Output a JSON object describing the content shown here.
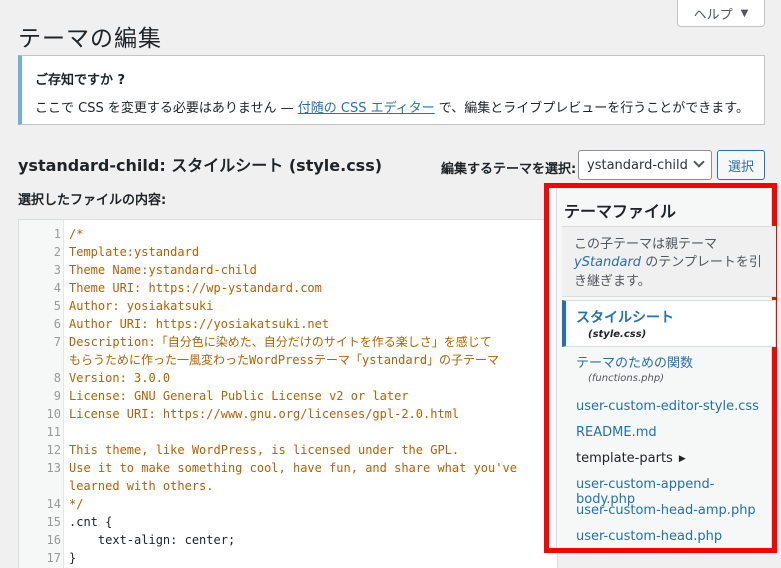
{
  "help": {
    "label": "ヘルプ",
    "caret": "▼"
  },
  "page": {
    "title": "テーマの編集"
  },
  "notice": {
    "title": "ご存知ですか ?",
    "text_before": "ここで CSS を変更する必要はありません — ",
    "link": "付随の CSS エディター",
    "text_after": " で、編集とライブプレビューを行うことができます。"
  },
  "file": {
    "theme_name": "ystandard-child:",
    "file_label": " スタイルシート (style.css)",
    "content_label": "選択したファイルの内容:"
  },
  "theme_select": {
    "label": "編集するテーマを選択:",
    "value": "ystandard-child",
    "button": "選択"
  },
  "code": {
    "lines": [
      {
        "n": "1",
        "t": "/*"
      },
      {
        "n": "2",
        "t": "Template:ystandard"
      },
      {
        "n": "3",
        "t": "Theme Name:ystandard-child"
      },
      {
        "n": "4",
        "t": "Theme URI: https://wp-ystandard.com"
      },
      {
        "n": "5",
        "t": "Author: yosiakatsuki"
      },
      {
        "n": "6",
        "t": "Author URI: https://yosiakatsuki.net"
      },
      {
        "n": "7",
        "t": "Description:「自分色に染めた、自分だけのサイトを作る楽しさ」を感じて"
      },
      {
        "n": "",
        "t": "もらうために作った一風変わったWordPressテーマ「ystandard」の子テーマ"
      },
      {
        "n": "8",
        "t": "Version: 3.0.0"
      },
      {
        "n": "9",
        "t": "License: GNU General Public License v2 or later"
      },
      {
        "n": "10",
        "t": "License URI: https://www.gnu.org/licenses/gpl-2.0.html"
      },
      {
        "n": "11",
        "t": ""
      },
      {
        "n": "12",
        "t": "This theme, like WordPress, is licensed under the GPL."
      },
      {
        "n": "13",
        "t": "Use it to make something cool, have fun, and share what you've"
      },
      {
        "n": "",
        "t": "learned with others."
      },
      {
        "n": "14",
        "t": "*/"
      },
      {
        "n": "15",
        "t": ".cnt {"
      },
      {
        "n": "16",
        "t": "    text-align: center;"
      },
      {
        "n": "17",
        "t": "}"
      }
    ]
  },
  "sidebar": {
    "title": "テーマファイル",
    "desc_before": "この子テーマは親テーマ ",
    "desc_parent": "yStandard",
    "desc_after": " のテンプレートを引き継ぎます。",
    "items": [
      {
        "label": "スタイルシート",
        "sub": "(style.css)"
      },
      {
        "label": "テーマのための関数",
        "sub": "(functions.php)"
      },
      {
        "label": "user-custom-editor-style.css"
      },
      {
        "label": "README.md"
      },
      {
        "label": "template-parts",
        "caret": "▶"
      },
      {
        "label": "user-custom-append-body.php"
      },
      {
        "label": "user-custom-head-amp.php"
      },
      {
        "label": "user-custom-head.php"
      }
    ]
  },
  "colors": {
    "accent": "#2271b1",
    "highlight_border": "#ff0000",
    "comment": "#b36200"
  }
}
